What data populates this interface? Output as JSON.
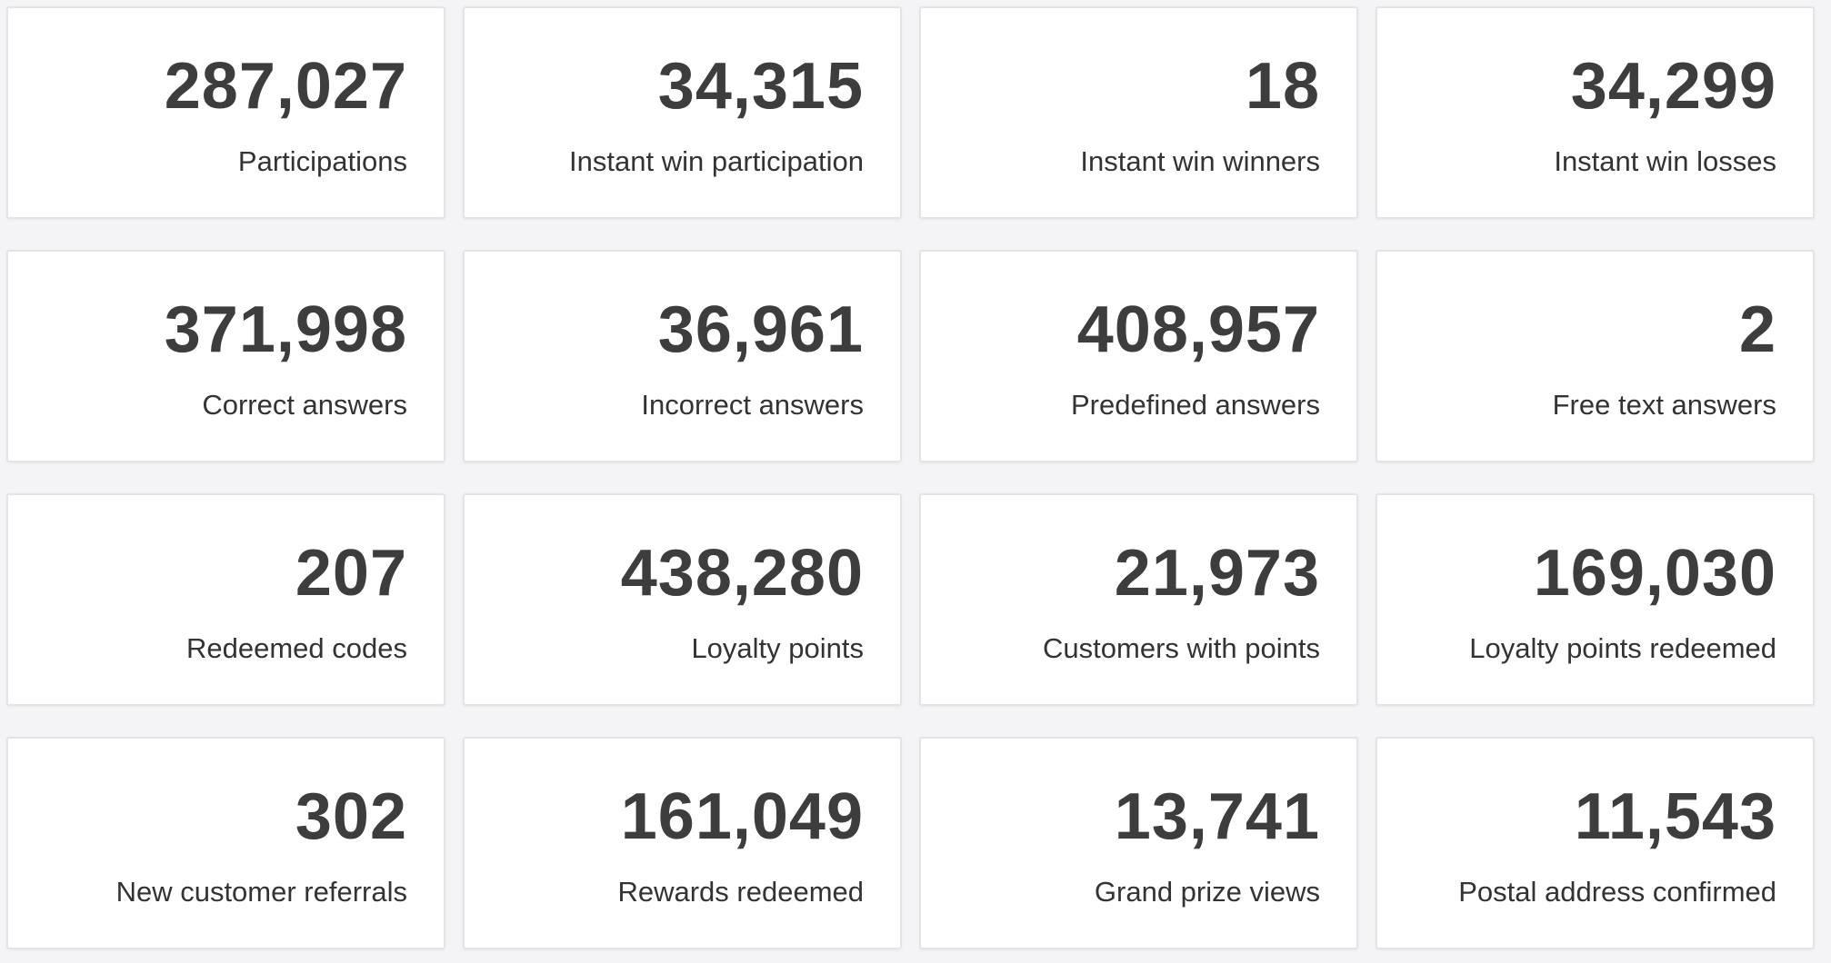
{
  "stats": [
    {
      "value": "287,027",
      "label": "Participations"
    },
    {
      "value": "34,315",
      "label": "Instant win participation"
    },
    {
      "value": "18",
      "label": "Instant win winners"
    },
    {
      "value": "34,299",
      "label": "Instant win losses"
    },
    {
      "value": "371,998",
      "label": "Correct answers"
    },
    {
      "value": "36,961",
      "label": "Incorrect answers"
    },
    {
      "value": "408,957",
      "label": "Predefined answers"
    },
    {
      "value": "2",
      "label": "Free text answers"
    },
    {
      "value": "207",
      "label": "Redeemed codes"
    },
    {
      "value": "438,280",
      "label": "Loyalty points"
    },
    {
      "value": "21,973",
      "label": "Customers with points"
    },
    {
      "value": "169,030",
      "label": "Loyalty points redeemed"
    },
    {
      "value": "302",
      "label": "New customer referrals"
    },
    {
      "value": "161,049",
      "label": "Rewards redeemed"
    },
    {
      "value": "13,741",
      "label": "Grand prize views"
    },
    {
      "value": "11,543",
      "label": "Postal address confirmed"
    }
  ]
}
